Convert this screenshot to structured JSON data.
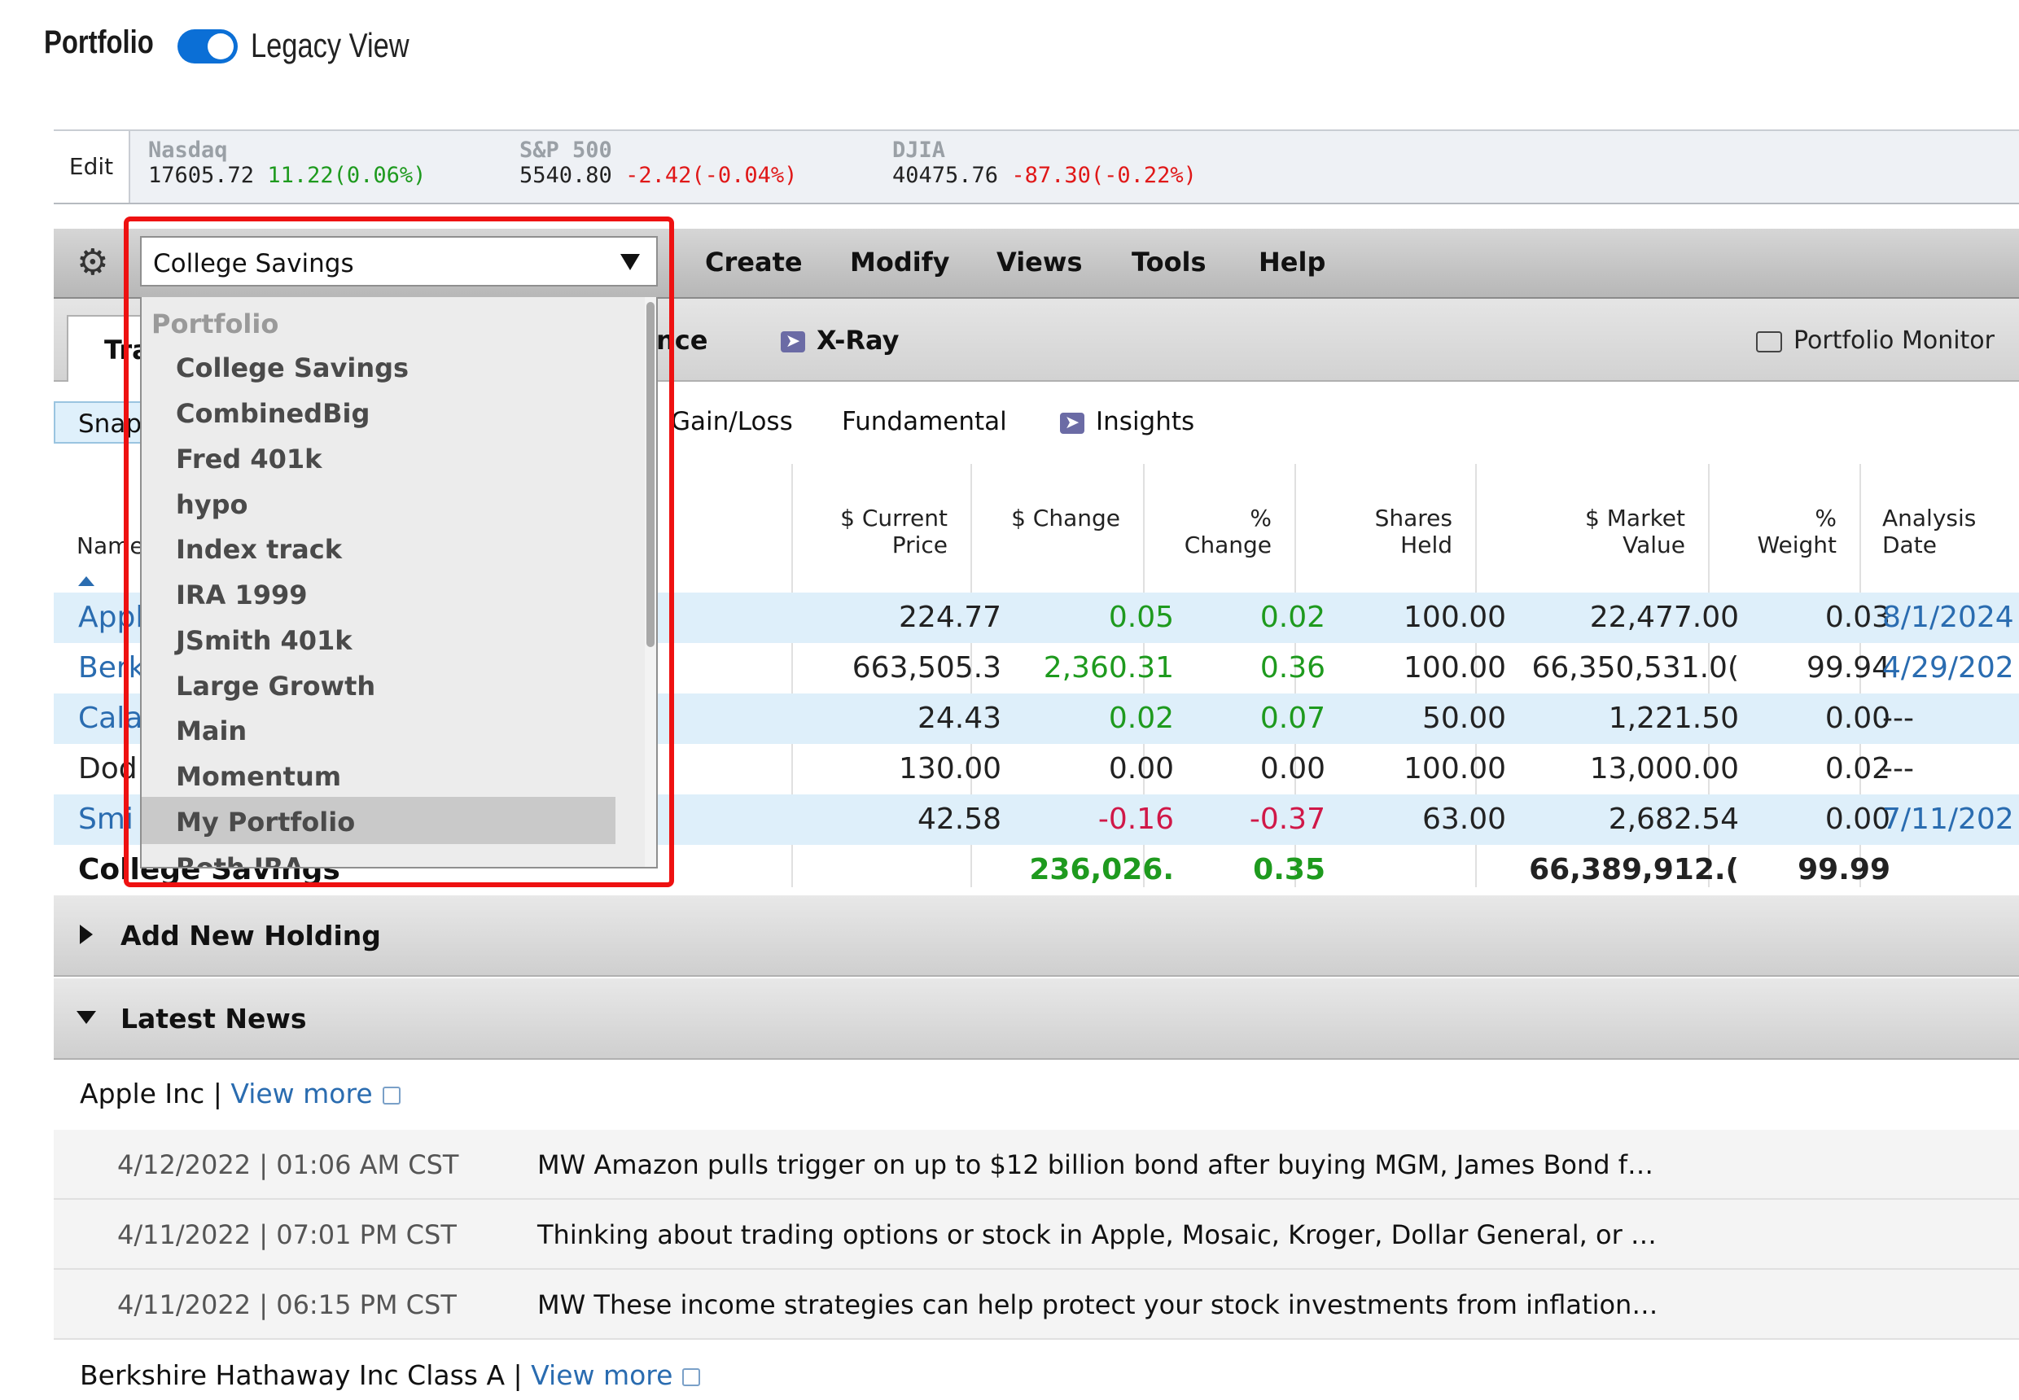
{
  "header": {
    "title": "Portfolio",
    "toggle_label": "Legacy View",
    "toggle_on": true
  },
  "market": {
    "edit_label": "Edit",
    "indices": [
      {
        "name": "Nasdaq",
        "value": "17605.72",
        "change": "11.22(0.06%)",
        "direction": "up"
      },
      {
        "name": "S&P 500",
        "value": "5540.80",
        "change": "-2.42(-0.04%)",
        "direction": "down"
      },
      {
        "name": "DJIA",
        "value": "40475.76",
        "change": "-87.30(-0.22%)",
        "direction": "down"
      }
    ]
  },
  "toolbar": {
    "selected_portfolio": "College Savings",
    "menus": [
      "Create",
      "Modify",
      "Views",
      "Tools",
      "Help"
    ]
  },
  "tabs": {
    "active": "Tra",
    "performance_fragment": "nce",
    "xray": "X-Ray",
    "portfolio_monitor": "Portfolio Monitor"
  },
  "subtabs": {
    "snapshot": "Snap",
    "gainloss": "Gain/Loss",
    "fundamental": "Fundamental",
    "insights": "Insights"
  },
  "table": {
    "headers": {
      "name": "Name",
      "current_price": [
        "$ Current",
        "Price"
      ],
      "change": [
        "$ Change"
      ],
      "pct_change": [
        "%",
        "Change"
      ],
      "shares": [
        "Shares",
        "Held"
      ],
      "market_value": [
        "$ Market",
        "Value"
      ],
      "weight": [
        "%",
        "Weight"
      ],
      "analysis_date": [
        "Analysis",
        "Date"
      ]
    },
    "rows": [
      {
        "name": "Appl",
        "price": "224.77",
        "change": "0.05",
        "pct": "0.02",
        "shares": "100.00",
        "value": "22,477.00",
        "weight": "0.03",
        "date": "8/1/2024",
        "dir": "up",
        "link": true
      },
      {
        "name": "Berk",
        "price": "663,505.3",
        "change": "2,360.31",
        "pct": "0.36",
        "shares": "100.00",
        "value": "66,350,531.0(",
        "weight": "99.94",
        "date": "4/29/202",
        "dir": "up",
        "link": true
      },
      {
        "name": "Cala",
        "price": "24.43",
        "change": "0.02",
        "pct": "0.07",
        "shares": "50.00",
        "value": "1,221.50",
        "weight": "0.00",
        "date": "---",
        "dir": "up",
        "link": true
      },
      {
        "name": "Dod",
        "price": "130.00",
        "change": "0.00",
        "pct": "0.00",
        "shares": "100.00",
        "value": "13,000.00",
        "weight": "0.02",
        "date": "---",
        "dir": "flat",
        "link": false
      },
      {
        "name": "Smi",
        "price": "42.58",
        "change": "-0.16",
        "pct": "-0.37",
        "shares": "63.00",
        "value": "2,682.54",
        "weight": "0.00",
        "date": "7/11/202",
        "dir": "down",
        "link": true
      }
    ],
    "totals": {
      "name": "College Savings",
      "change": "236,026.",
      "pct": "0.35",
      "value": "66,389,912.(",
      "weight": "99.99"
    }
  },
  "dropdown": {
    "group_label": "Portfolio",
    "options": [
      "College Savings",
      "CombinedBig",
      "Fred 401k",
      "hypo",
      "Index track",
      "IRA 1999",
      "JSmith 401k",
      "Large Growth",
      "Main",
      "Momentum",
      "My Portfolio",
      "Roth IRA"
    ],
    "hovered": "My Portfolio"
  },
  "sections": {
    "add_holding": "Add New Holding",
    "latest_news": "Latest News"
  },
  "news": {
    "company1": "Apple Inc",
    "separator": "|",
    "view_more": "View more",
    "items": [
      {
        "date": "4/12/2022 | 01:06 AM CST",
        "headline": "MW Amazon pulls trigger on up to $12 billion bond after buying MGM, James Bond f…"
      },
      {
        "date": "4/11/2022 | 07:01 PM CST",
        "headline": "Thinking about trading options or stock in Apple, Mosaic, Kroger, Dollar General, or …"
      },
      {
        "date": "4/11/2022 | 06:15 PM CST",
        "headline": "MW These income strategies can help protect your stock investments from inflation…"
      }
    ],
    "company2": "Berkshire Hathaway Inc Class A"
  },
  "colors": {
    "accent": "#0b6fd6",
    "positive": "#1e9a1e",
    "negative": "#d01848",
    "highlight": "#ee1111",
    "link": "#2a6cb0"
  }
}
